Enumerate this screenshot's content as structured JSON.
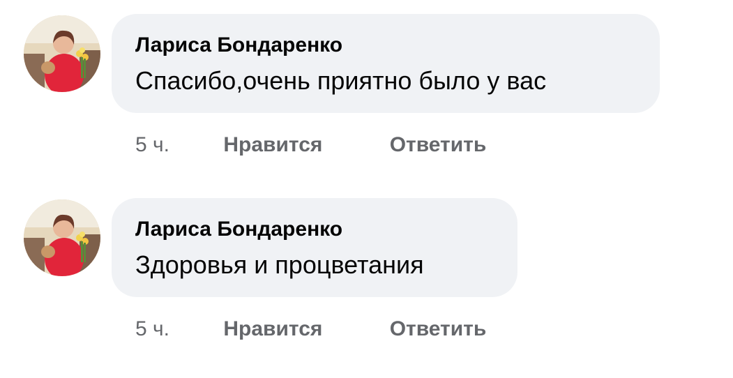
{
  "comments": [
    {
      "author": "Лариса Бондаренко",
      "text": "Спасибо,очень приятно было у вас",
      "time": "5 ч.",
      "like_label": "Нравится",
      "reply_label": "Ответить"
    },
    {
      "author": "Лариса Бондаренко",
      "text": "Здоровья и процветания",
      "time": "5 ч.",
      "like_label": "Нравится",
      "reply_label": "Ответить"
    }
  ],
  "colors": {
    "bubble_bg": "#f0f2f5",
    "text": "#050505",
    "meta": "#65676b"
  }
}
